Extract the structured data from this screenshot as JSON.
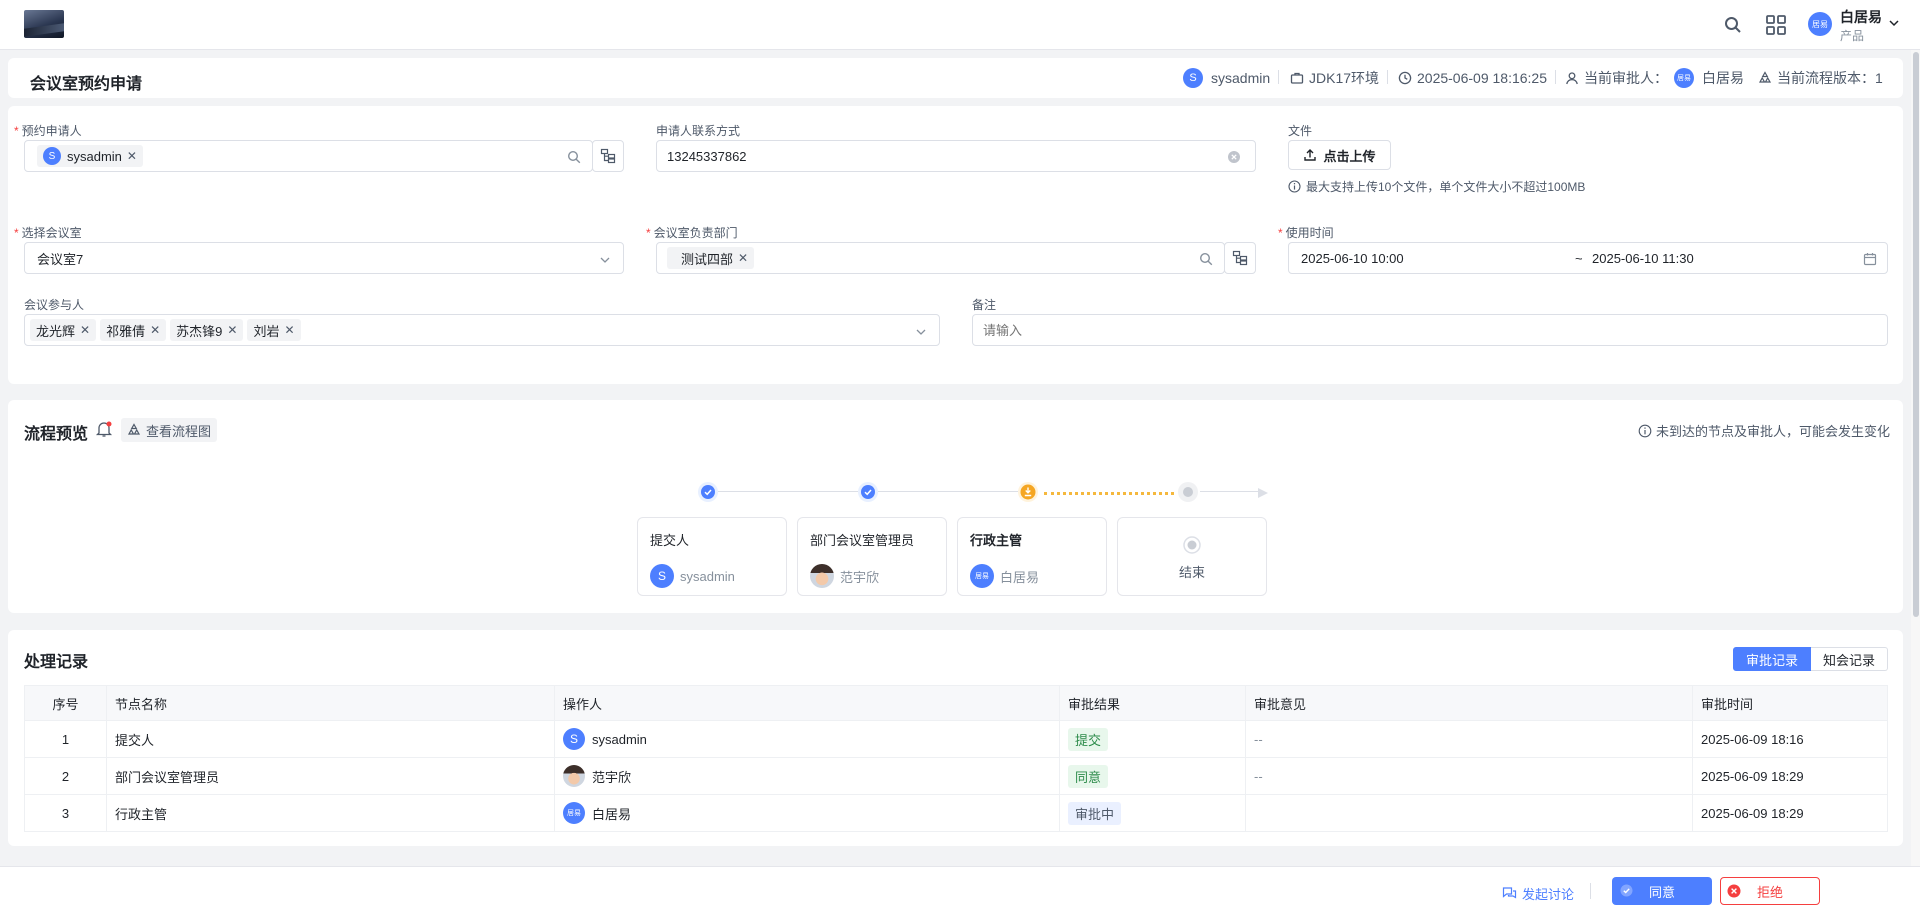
{
  "app": {
    "user_name": "白居易",
    "user_role": "产品",
    "user_avatar": "居易"
  },
  "header": {
    "title": "会议室预约申请",
    "creator": "sysadmin",
    "creator_avatar": "S",
    "environment": "JDK17环境",
    "datetime": "2025-06-09 18:16:25",
    "approver_label": "当前审批人：",
    "approver": "白居易",
    "approver_avatar": "居易",
    "version_label": "当前流程版本：1"
  },
  "form": {
    "applicant": {
      "label": "预约申请人",
      "required": true,
      "tag": "sysadmin",
      "tag_avatar": "S"
    },
    "contact": {
      "label": "申请人联系方式",
      "value": "13245337862"
    },
    "file": {
      "label": "文件",
      "upload_label": "点击上传",
      "tip": "最大支持上传10个文件，单个文件大小不超过100MB"
    },
    "room": {
      "label": "选择会议室",
      "required": true,
      "value": "会议室7"
    },
    "dept": {
      "label": "会议室负责部门",
      "required": true,
      "tag": "测试四部"
    },
    "time": {
      "label": "使用时间",
      "required": true,
      "start": "2025-06-10 10:00",
      "sep": "~",
      "end": "2025-06-10 11:30"
    },
    "participants": {
      "label": "会议参与人",
      "tags": [
        "龙光辉",
        "祁雅倩",
        "苏杰锋9",
        "刘岩"
      ]
    },
    "remark": {
      "label": "备注",
      "placeholder": "请输入"
    }
  },
  "process": {
    "title": "流程预览",
    "view_label": "查看流程图",
    "tip": "未到达的节点及审批人，可能会发生变化",
    "steps": [
      {
        "name": "提交人",
        "user": "sysadmin",
        "avatar": "S",
        "status": "done"
      },
      {
        "name": "部门会议室管理员",
        "user": "范宇欣",
        "avatar": "",
        "status": "done"
      },
      {
        "name": "行政主管",
        "user": "白居易",
        "avatar": "居易",
        "status": "current"
      },
      {
        "name": "结束",
        "user": "",
        "avatar": "",
        "status": "pending"
      }
    ]
  },
  "records": {
    "title": "处理记录",
    "tabs": [
      "审批记录",
      "知会记录"
    ],
    "columns": [
      "序号",
      "节点名称",
      "操作人",
      "审批结果",
      "审批意见",
      "审批时间"
    ],
    "rows": [
      {
        "no": "1",
        "node": "提交人",
        "operator": "sysadmin",
        "avatar": "S",
        "result": "提交",
        "opinion": "--",
        "time": "2025-06-09 18:16"
      },
      {
        "no": "2",
        "node": "部门会议室管理员",
        "operator": "范宇欣",
        "avatar": "",
        "result": "同意",
        "opinion": "--",
        "time": "2025-06-09 18:29"
      },
      {
        "no": "3",
        "node": "行政主管",
        "operator": "白居易",
        "avatar": "居易",
        "result": "审批中",
        "opinion": "",
        "time": "2025-06-09 18:29"
      }
    ]
  },
  "footer": {
    "discuss_label": "发起讨论",
    "approve_label": "同意",
    "reject_label": "拒绝"
  },
  "colors": {
    "primary": "#4d7fff",
    "danger": "#f53f3f",
    "warning": "#f5a623",
    "success_bg": "#e8f7ec"
  }
}
